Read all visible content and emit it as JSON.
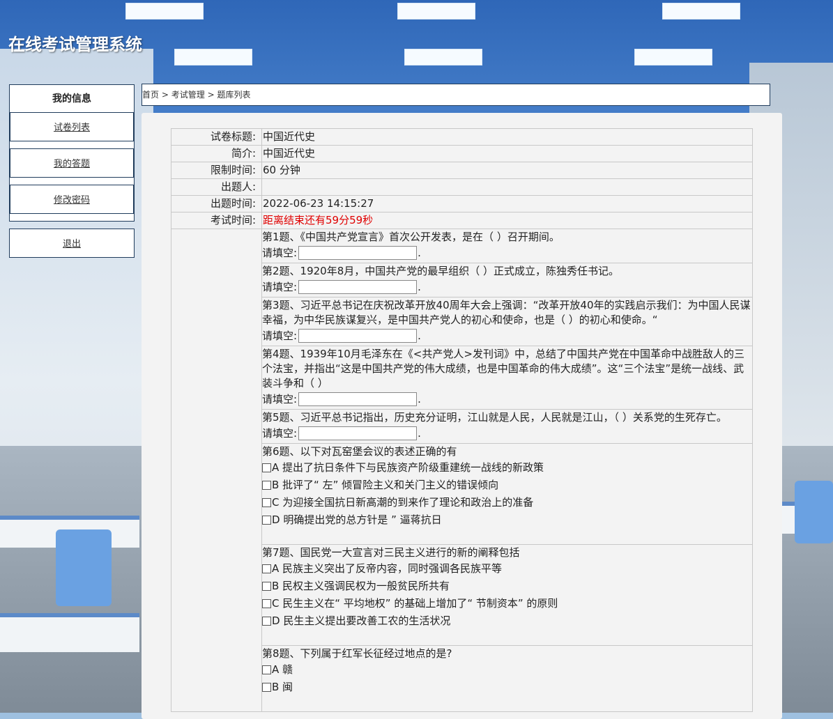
{
  "app": {
    "title": "在线考试管理系统"
  },
  "sidebar": {
    "header": "我的信息",
    "items": [
      {
        "label": "试卷列表"
      },
      {
        "label": "我的答题"
      },
      {
        "label": "修改密码"
      }
    ],
    "logout": "退出"
  },
  "breadcrumb": {
    "home": "首页",
    "sep": ">",
    "section": "考试管理",
    "current": "题库列表"
  },
  "exam": {
    "title_label": "试卷标题:",
    "title": "中国近代史",
    "intro_label": "简介:",
    "intro": "中国近代史",
    "limit_label": "限制时间:",
    "limit": "60 分钟",
    "author_label": "出题人:",
    "author": "",
    "created_label": "出题时间:",
    "created": "2022-06-23 14:15:27",
    "time_label": "考试时间:",
    "countdown": "距离结束还有59分59秒"
  },
  "fill_prompt": "请填空:",
  "fill_end": ".",
  "questions": [
    {
      "text": "第1题、《中国共产党宣言》首次公开发表，是在（ ）召开期间。"
    },
    {
      "text": "第2题、1920年8月，中国共产党的最早组织（ ）正式成立，陈独秀任书记。"
    },
    {
      "text": "第3题、习近平总书记在庆祝改革开放40周年大会上强调：“改革开放40年的实践启示我们：为中国人民谋幸福，为中华民族谋复兴，是中国共产党人的初心和使命，也是（ ）的初心和使命。“"
    },
    {
      "text": "第4题、1939年10月毛泽东在《<共产党人>发刊词》中，总结了中国共产党在中国革命中战胜敌人的三个法宝，并指出“这是中国共产党的伟大成绩，也是中国革命的伟大成绩”。这“三个法宝”是统一战线、武装斗争和（ ）"
    },
    {
      "text": "第5题、习近平总书记指出，历史充分证明，江山就是人民，人民就是江山，（ ）关系党的生死存亡。"
    },
    {
      "text": "第6题、以下对瓦窑堡会议的表述正确的有",
      "options": [
        "A 提出了抗日条件下与民族资产阶级重建统一战线的新政策",
        "B 批评了“ 左” 倾冒险主义和关门主义的错误倾向",
        "C 为迎接全国抗日新高潮的到来作了理论和政治上的准备",
        "D 明确提出党的总方针是 ” 逼蒋抗日"
      ]
    },
    {
      "text": "第7题、国民党一大宣言对三民主义进行的新的阐释包括",
      "options": [
        "A 民族主义突出了反帝内容，同时强调各民族平等",
        "B 民权主义强调民权为一般贫民所共有",
        "C 民生主义在“ 平均地权” 的基础上增加了“ 节制资本” 的原则",
        "D 民生主义提出要改善工农的生活状况"
      ]
    },
    {
      "text": "第8题、下列属于红军长征经过地点的是?",
      "options": [
        "A 赣",
        "B 闽"
      ]
    }
  ]
}
